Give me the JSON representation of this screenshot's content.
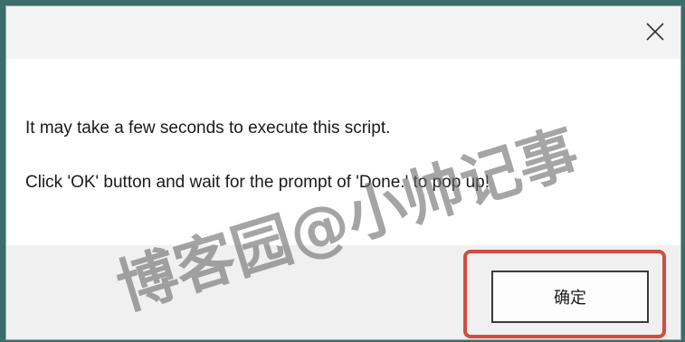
{
  "dialog": {
    "close_icon": "close-icon",
    "message_line1": "It may take a few seconds to execute this script.",
    "message_line2": "Click 'OK' button and wait for the prompt of 'Done.' to pop up!",
    "ok_button_label": "确定",
    "highlight_color": "#cf4d40"
  },
  "watermark": {
    "text": "博客园@小帅记事"
  }
}
